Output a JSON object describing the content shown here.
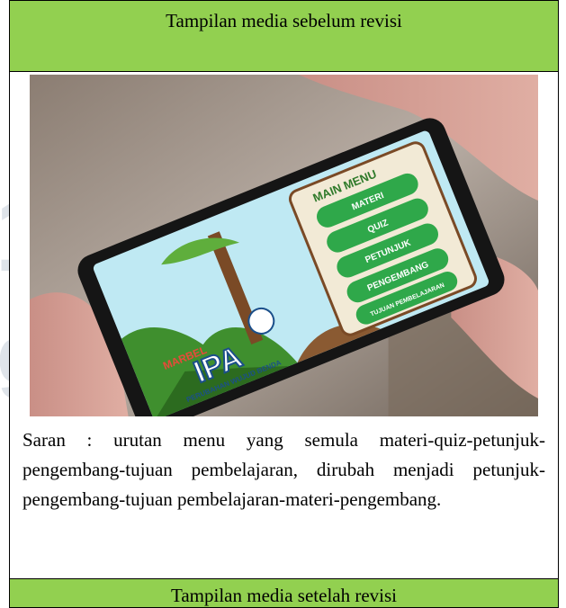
{
  "header_before": "Tampilan media sebelum revisi",
  "header_after": "Tampilan media setelah revisi",
  "saran_text": "Saran : urutan menu yang semula materi-quiz-petunjuk-pengembang-tujuan pembelajaran, dirubah menjadi petunjuk-pengembang-tujuan pembelajaran-materi-pengembang.",
  "photo": {
    "logo_top": "MARBEL",
    "logo_main": "IPA",
    "logo_sub": "PERUBAHAN WUJUD BENDA",
    "menu_title": "MAIN MENU",
    "menu_items": [
      "MATERI",
      "QUIZ",
      "PETUNJUK",
      "PENGEMBANG",
      "TUJUAN PEMBELAJARAN"
    ]
  },
  "colors": {
    "header_bg": "#92d050",
    "menu_button": "#2fa84a",
    "menu_panel": "#f2ead6",
    "sky": "#bfe9f3"
  }
}
